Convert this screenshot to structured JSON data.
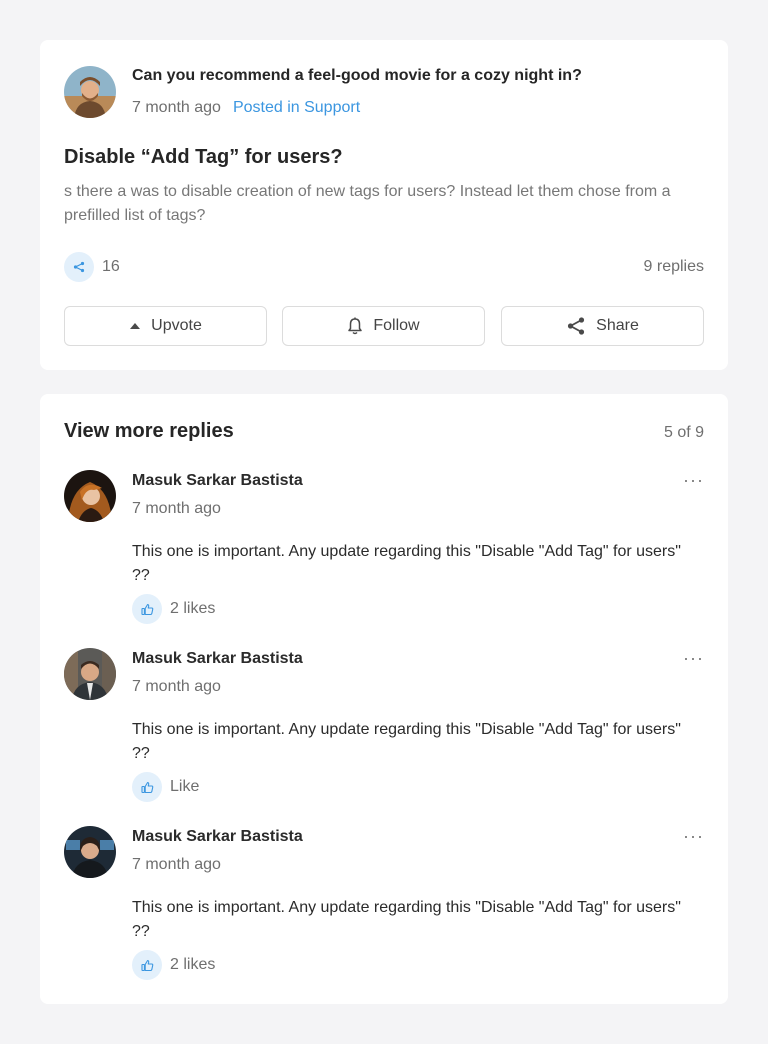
{
  "post": {
    "question": "Can you recommend a feel-good movie for a cozy night in?",
    "time": "7 month ago",
    "posted_in": "Posted in Support",
    "title": "Disable “Add Tag” for users?",
    "body": "s there a was to disable creation of new tags for users? Instead let them chose from a prefilled list of tags?",
    "share_count": "16",
    "replies_count": "9 replies",
    "icons": {
      "share": "share-icon",
      "upvote": "caret-up-icon",
      "follow": "bell-icon"
    },
    "actions": {
      "upvote": "Upvote",
      "follow": "Follow",
      "share": "Share"
    }
  },
  "replies": {
    "heading": "View more replies",
    "pager": "5 of 9",
    "items": [
      {
        "author": "Masuk Sarkar Bastista",
        "time": "7 month ago",
        "text": "This one is important. Any update regarding this \"Disable \"Add Tag\" for users\" ??",
        "like_label": "2 likes",
        "more": "···"
      },
      {
        "author": "Masuk Sarkar Bastista",
        "time": "7 month ago",
        "text": "This one is important. Any update regarding this \"Disable \"Add Tag\" for users\" ??",
        "like_label": "Like",
        "more": "···"
      },
      {
        "author": "Masuk Sarkar Bastista",
        "time": "7 month ago",
        "text": "This one is important. Any update regarding this \"Disable \"Add Tag\" for users\" ??",
        "like_label": "2 likes",
        "more": "···"
      }
    ]
  },
  "colors": {
    "background": "#f4f4f6",
    "card": "#ffffff",
    "link": "#3b96e0",
    "icon_bg": "#e3f0fb",
    "muted_text": "#6f6f6f"
  }
}
